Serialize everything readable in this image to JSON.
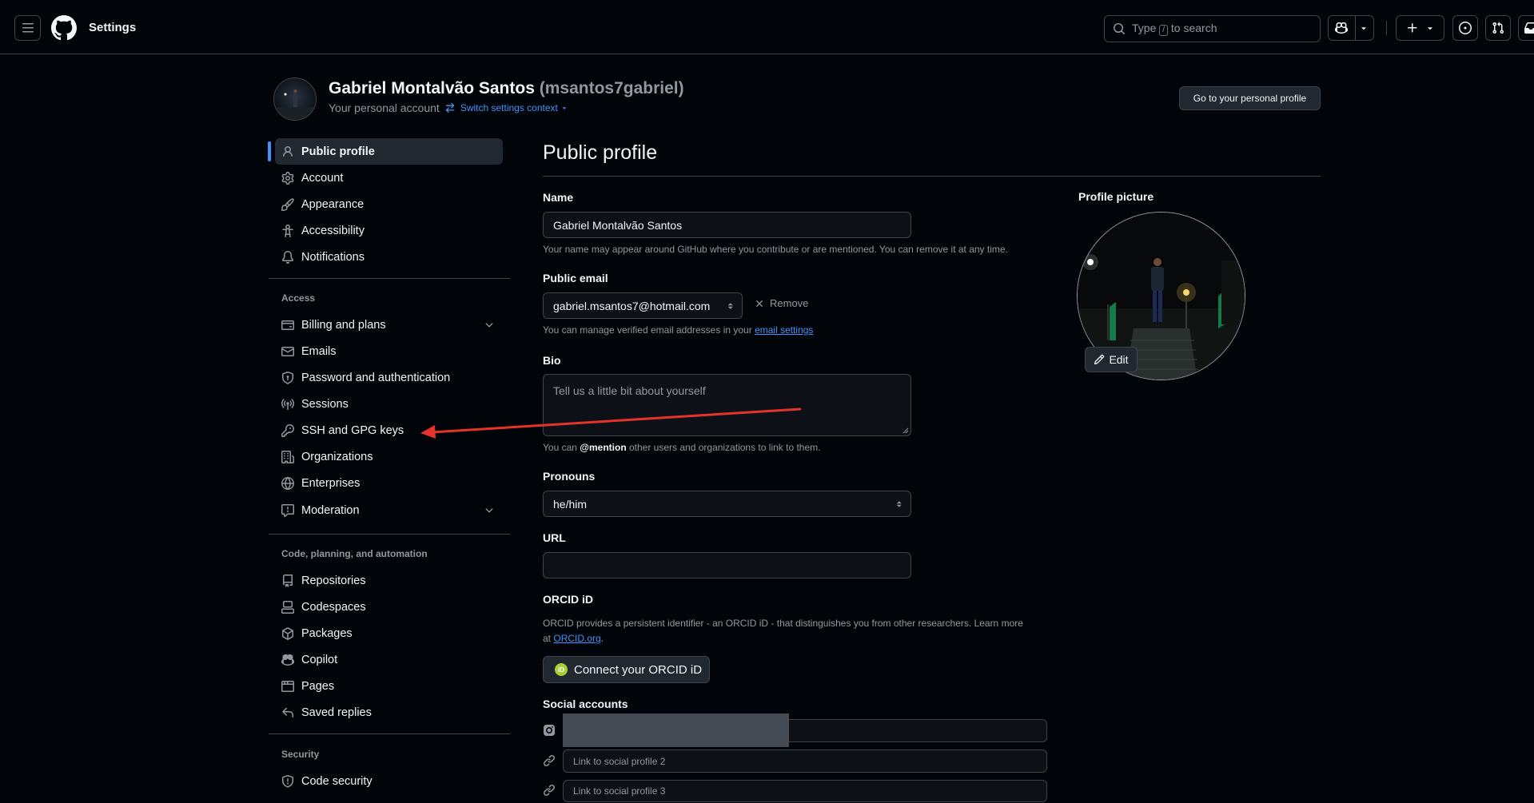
{
  "header": {
    "title": "Settings",
    "search_prefix": "Type",
    "search_key": "/",
    "search_suffix": "to search"
  },
  "user": {
    "name": "Gabriel Montalvão Santos",
    "login": "(msantos7gabriel)",
    "subtitle": "Your personal account",
    "switch_context": "Switch settings context",
    "profile_button": "Go to your personal profile"
  },
  "sidebar": {
    "top_items": [
      {
        "label": "Public profile",
        "icon": "person-icon"
      },
      {
        "label": "Account",
        "icon": "gear-icon"
      },
      {
        "label": "Appearance",
        "icon": "paintbrush-icon"
      },
      {
        "label": "Accessibility",
        "icon": "accessibility-icon"
      },
      {
        "label": "Notifications",
        "icon": "bell-icon"
      }
    ],
    "access_header": "Access",
    "access_items": [
      {
        "label": "Billing and plans",
        "icon": "credit-card-icon"
      },
      {
        "label": "Emails",
        "icon": "mail-icon"
      },
      {
        "label": "Password and authentication",
        "icon": "shield-lock-icon"
      },
      {
        "label": "Sessions",
        "icon": "broadcast-icon"
      },
      {
        "label": "SSH and GPG keys",
        "icon": "key-icon"
      },
      {
        "label": "Organizations",
        "icon": "organization-icon"
      },
      {
        "label": "Enterprises",
        "icon": "globe-icon"
      },
      {
        "label": "Moderation",
        "icon": "report-icon"
      }
    ],
    "code_header": "Code, planning, and automation",
    "code_items": [
      {
        "label": "Repositories",
        "icon": "repo-icon"
      },
      {
        "label": "Codespaces",
        "icon": "codespaces-icon"
      },
      {
        "label": "Packages",
        "icon": "package-icon"
      },
      {
        "label": "Copilot",
        "icon": "copilot-icon"
      },
      {
        "label": "Pages",
        "icon": "browser-icon"
      },
      {
        "label": "Saved replies",
        "icon": "reply-icon"
      }
    ],
    "security_header": "Security",
    "security_items": [
      {
        "label": "Code security",
        "icon": "shield-icon"
      }
    ]
  },
  "main": {
    "title": "Public profile",
    "name_label": "Name",
    "name_value": "Gabriel Montalvão Santos",
    "name_hint": "Your name may appear around GitHub where you contribute or are mentioned. You can remove it at any time.",
    "email_label": "Public email",
    "email_value": "gabriel.msantos7@hotmail.com",
    "remove_label": "Remove",
    "email_hint_prefix": "You can manage verified email addresses in your",
    "email_hint_link": "email settings",
    "bio_label": "Bio",
    "bio_placeholder": "Tell us a little bit about yourself",
    "bio_hint_prefix": "You can",
    "bio_hint_mention": "@mention",
    "bio_hint_suffix": "other users and organizations to link to them.",
    "pronouns_label": "Pronouns",
    "pronouns_value": "he/him",
    "url_label": "URL",
    "url_value": "",
    "orcid_label": "ORCID iD",
    "orcid_hint_1": "ORCID provides a persistent identifier - an ORCID iD - that distinguishes you from other researchers. Learn more",
    "orcid_hint_2": "at",
    "orcid_link": "ORCID.org",
    "orcid_button": "Connect your ORCID iD",
    "orcid_badge": "iD",
    "social_label": "Social accounts",
    "social_2_placeholder": "Link to social profile 2",
    "social_3_placeholder": "Link to social profile 3"
  },
  "profile_picture": {
    "label": "Profile picture",
    "edit": "Edit"
  },
  "colors": {
    "accent": "#4493f8",
    "annotation_arrow": "#e5322b",
    "background": "#010409"
  }
}
